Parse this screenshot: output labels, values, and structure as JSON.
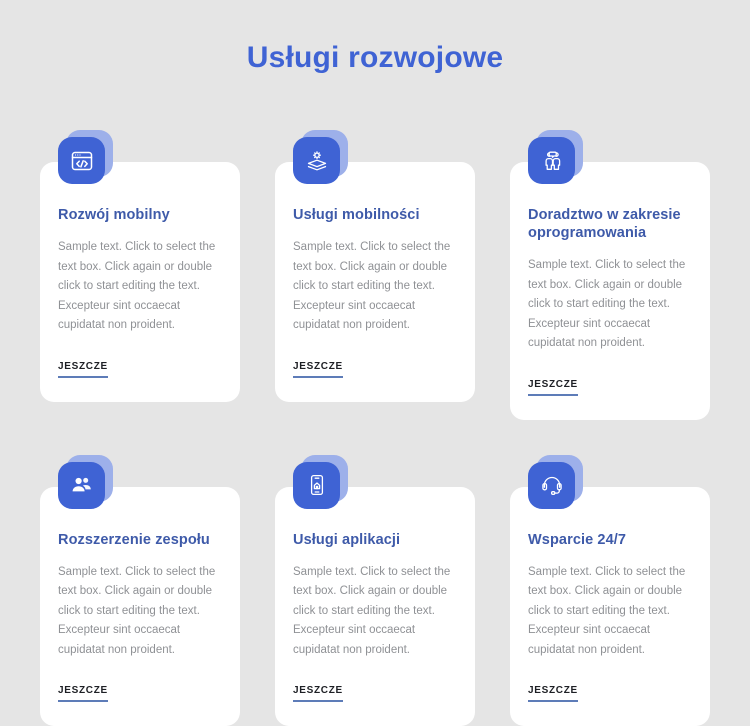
{
  "page": {
    "title": "Usługi rozwojowe",
    "background_color": "#e5e5e5",
    "accent_color": "#3f63d4",
    "title_color": "#3f63d4",
    "card_title_color": "#3e5aa9",
    "card_background": "#ffffff"
  },
  "cards": [
    {
      "icon": "code-browser-icon",
      "title": "Rozwój mobilny",
      "text": "Sample text. Click to select the text box. Click again or double click to start editing the text. Excepteur sint occaecat cupidatat non proident.",
      "link_label": "JESZCZE"
    },
    {
      "icon": "layers-gear-icon",
      "title": "Usługi mobilności",
      "text": "Sample text. Click to select the text box. Click again or double click to start editing the text. Excepteur sint occaecat cupidatat non proident.",
      "link_label": "JESZCZE"
    },
    {
      "icon": "consulting-people-icon",
      "title": "Doradztwo w zakresie oprogramowania",
      "text": "Sample text. Click to select the text box. Click again or double click to start editing the text. Excepteur sint occaecat cupidatat non proident.",
      "link_label": "JESZCZE"
    },
    {
      "icon": "team-group-icon",
      "title": "Rozszerzenie zespołu",
      "text": "Sample text. Click to select the text box. Click again or double click to start editing the text. Excepteur sint occaecat cupidatat non proident.",
      "link_label": "JESZCZE"
    },
    {
      "icon": "mobile-app-icon",
      "title": "Usługi aplikacji",
      "text": "Sample text. Click to select the text box. Click again or double click to start editing the text. Excepteur sint occaecat cupidatat non proident.",
      "link_label": "JESZCZE"
    },
    {
      "icon": "headset-support-icon",
      "title": "Wsparcie 24/7",
      "text": "Sample text. Click to select the text box. Click again or double click to start editing the text. Excepteur sint occaecat cupidatat non proident.",
      "link_label": "JESZCZE"
    }
  ]
}
